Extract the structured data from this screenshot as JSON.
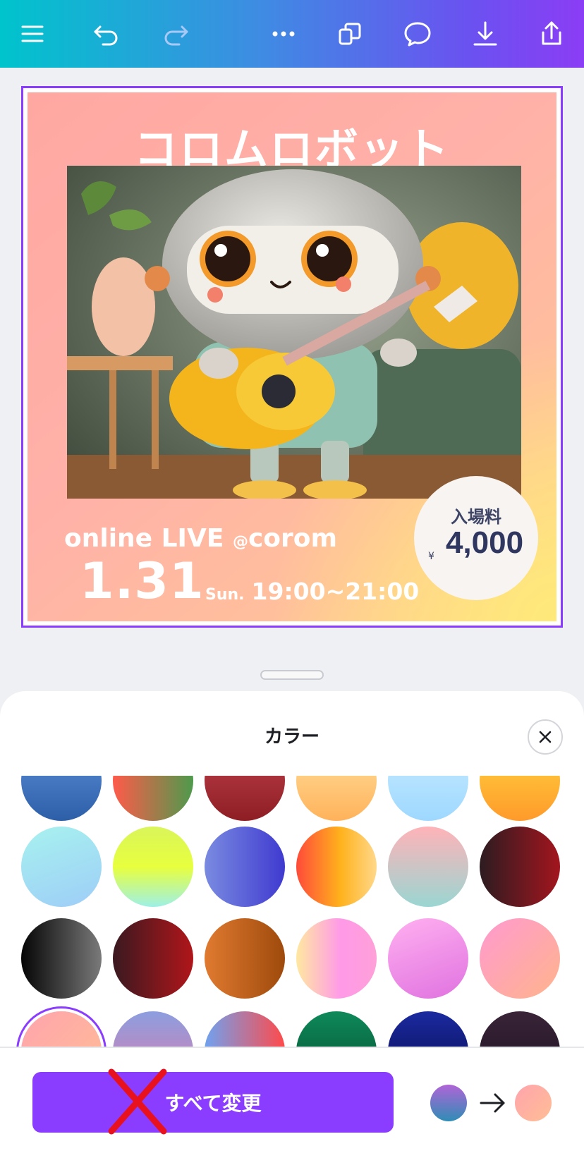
{
  "toolbar": {
    "icons": [
      "menu-icon",
      "undo-icon",
      "redo-icon",
      "more-icon",
      "duplicate-icon",
      "comment-icon",
      "download-icon",
      "share-icon"
    ]
  },
  "design": {
    "title": "コロムロボット",
    "live_prefix": "online LIVE",
    "live_at": "@",
    "live_suffix": "corom",
    "date": "1.31",
    "day_of_week": "Sun.",
    "time": "19:00~21:00",
    "price_label": "入場料",
    "price_currency": "¥",
    "price_value": "4,000"
  },
  "sheet": {
    "title": "カラー",
    "apply_all_label": "すべて変更",
    "swatches": [
      {
        "row": 0,
        "col": 0,
        "gradient": "linear-gradient(180deg,#5b8fd6,#2d5fa8)"
      },
      {
        "row": 0,
        "col": 1,
        "gradient": "linear-gradient(90deg,#ff5a4a,#4e9a4c)"
      },
      {
        "row": 0,
        "col": 2,
        "gradient": "linear-gradient(180deg,#c0434c,#8e1d24)"
      },
      {
        "row": 0,
        "col": 3,
        "gradient": "linear-gradient(180deg,#ffe2a0,#ffb25a)"
      },
      {
        "row": 0,
        "col": 4,
        "gradient": "linear-gradient(180deg,#c8ecff,#9ed8ff)"
      },
      {
        "row": 0,
        "col": 5,
        "gradient": "linear-gradient(180deg,#ffd640,#ff9a2a)"
      },
      {
        "row": 1,
        "col": 0,
        "gradient": "linear-gradient(160deg,#a7f2ef,#9ecdf7)"
      },
      {
        "row": 1,
        "col": 1,
        "gradient": "linear-gradient(180deg,#d9f55a,#e8ff3e 50%,#9ef0e6)"
      },
      {
        "row": 1,
        "col": 2,
        "gradient": "linear-gradient(90deg,#7a8be0,#3f3ad0)"
      },
      {
        "row": 1,
        "col": 3,
        "gradient": "linear-gradient(90deg,#ff4a3a,#ffb21c 55%,#ffd88a)"
      },
      {
        "row": 1,
        "col": 4,
        "gradient": "linear-gradient(180deg,#ffb3b8,#9ad6d2)"
      },
      {
        "row": 1,
        "col": 5,
        "gradient": "linear-gradient(90deg,#2c1c21,#a3151e)"
      },
      {
        "row": 2,
        "col": 0,
        "gradient": "linear-gradient(90deg,#050505,#7a7a7a)"
      },
      {
        "row": 2,
        "col": 1,
        "gradient": "linear-gradient(90deg,#3a1920,#b0161a)"
      },
      {
        "row": 2,
        "col": 2,
        "gradient": "linear-gradient(90deg,#e07a30,#9e4a0c)"
      },
      {
        "row": 2,
        "col": 3,
        "gradient": "linear-gradient(90deg,#ffe8a0,#ff9ae8 55%,#ffa0d8)"
      },
      {
        "row": 2,
        "col": 4,
        "gradient": "linear-gradient(160deg,#ffb0f0,#e072e0)"
      },
      {
        "row": 2,
        "col": 5,
        "gradient": "linear-gradient(135deg,#ff9ad0,#ffb48c)"
      },
      {
        "row": 3,
        "col": 0,
        "gradient": "linear-gradient(135deg,#ffa4ad,#ffbe95)",
        "selected": true
      },
      {
        "row": 3,
        "col": 1,
        "gradient": "linear-gradient(180deg,#8c9ee0,#e07aa8)"
      },
      {
        "row": 3,
        "col": 2,
        "gradient": "linear-gradient(90deg,#6fa2f0,#ff4a4a)"
      },
      {
        "row": 3,
        "col": 3,
        "gradient": "linear-gradient(180deg,#0e8a5a,#064a2e)"
      },
      {
        "row": 3,
        "col": 4,
        "gradient": "linear-gradient(180deg,#1a2aa0,#0a0a4a)"
      },
      {
        "row": 3,
        "col": 5,
        "gradient": "linear-gradient(180deg,#3a2438,#1a1020)"
      }
    ],
    "from_color": "#9a6fd0",
    "to_color": "#ffb09e"
  }
}
